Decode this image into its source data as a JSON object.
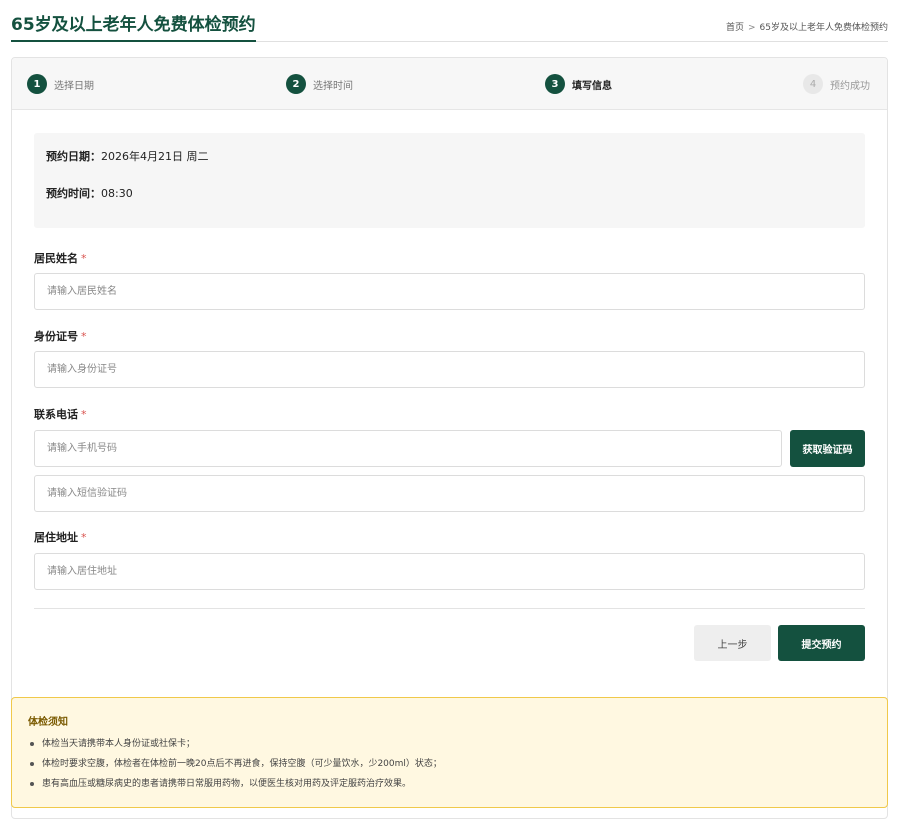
{
  "header": {
    "title": "65岁及以上老年人免费体检预约",
    "breadcrumb": {
      "home": "首页",
      "separator": ">",
      "current": "65岁及以上老年人免费体检预约"
    }
  },
  "steps": [
    {
      "number": "1",
      "label": "选择日期",
      "state": "done"
    },
    {
      "number": "2",
      "label": "选择时间",
      "state": "done"
    },
    {
      "number": "3",
      "label": "填写信息",
      "state": "active"
    },
    {
      "number": "4",
      "label": "预约成功",
      "state": "todo"
    }
  ],
  "summary": {
    "date_key": "预约日期：",
    "date_value": "2026年4月21日 周二",
    "time_key": "预约时间：",
    "time_value": "08:30"
  },
  "form": {
    "required_mark": "*",
    "name_label": "居民姓名",
    "name_placeholder": "请输入居民姓名",
    "id_label": "身份证号",
    "id_placeholder": "请输入身份证号",
    "phone_label": "联系电话",
    "phone_placeholder": "请输入手机号码",
    "code_button": "获取验证码",
    "sms_placeholder": "请输入短信验证码",
    "address_label": "居住地址",
    "address_placeholder": "请输入居住地址",
    "prev_button": "上一步",
    "submit_button": "提交预约"
  },
  "notice": {
    "title": "体检须知",
    "items": [
      "体检当天请携带本人身份证或社保卡；",
      "体检时要求空腹，体检者在体检前一晚20点后不再进食，保持空腹（可少量饮水，少200ml）状态；",
      "患有高血压或糖尿病史的患者请携带日常服用药物，以便医生核对用药及评定服药治疗效果。"
    ]
  },
  "colors": {
    "primary": "#14513f",
    "required": "#d9534f",
    "notice_bg": "#fff8e1",
    "notice_border": "#f0c94a",
    "notice_title": "#7a5a00"
  }
}
